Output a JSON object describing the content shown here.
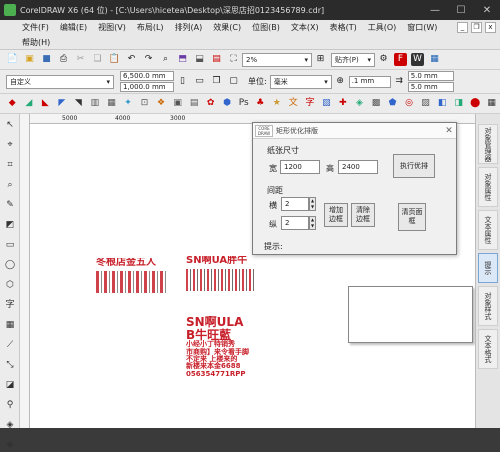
{
  "window": {
    "title": "CorelDRAW X6 (64 位) - [C:\\Users\\hicetea\\Desktop\\深思店招0123456789.cdr]",
    "minimize": "—",
    "maximize": "☐",
    "close": "✕"
  },
  "menu": {
    "items": [
      "文件(F)",
      "编辑(E)",
      "视图(V)",
      "布局(L)",
      "排列(A)",
      "效果(C)",
      "位图(B)",
      "文本(X)",
      "表格(T)",
      "工具(O)",
      "窗口(W)"
    ],
    "help": "帮助(H)"
  },
  "toolbar1": {
    "zoom": "2%",
    "snap": "贴齐(P)"
  },
  "toolbar2": {
    "page_size": "自定义",
    "width": "6,500.0 mm",
    "height": "1,000.0 mm",
    "units_label": "单位:",
    "units": "毫米",
    "nudge": ".1 mm",
    "dup_x": "5.0 mm",
    "dup_y": "5.0 mm"
  },
  "ruler": {
    "ticks": [
      "5000",
      "4000",
      "3000"
    ]
  },
  "dialog": {
    "logo_text": "CORE DRAW",
    "title": "矩形优化排版",
    "paper_label": "纸张尺寸",
    "width_label": "宽",
    "width_value": "1200",
    "height_label": "高",
    "height_value": "2400",
    "run_button": "执行优排",
    "spacing_label": "间距",
    "horiz_label": "横",
    "horiz_value": "2",
    "vert_label": "纵",
    "vert_value": "2",
    "add_border": "增加边框",
    "clear_border": "清除边框",
    "clear_page": "清页面框",
    "hint_label": "提示:"
  },
  "artwork": {
    "a1": "冬根店金五人",
    "a2": "SN啊UA胖牛",
    "a3_line1": "SN啊ULA",
    "a3_line2": "B牛旺藍",
    "a3_line3": "小经小丁特销秀",
    "a3_line4": "市商购】来令看手脚",
    "a3_line5": "不定来 上楼来的",
    "a3_line6": "新楼来本金6688",
    "a3_line7": "056354771RPP"
  },
  "dock": {
    "tabs": [
      "对象管理器",
      "对象属性",
      "文本属性",
      "提示",
      "对象样式",
      "文本格式"
    ]
  },
  "colors": {
    "accent_red": "#c8202a",
    "dialog_bg": "#f0f0f0",
    "titlebar": "#2b2b2b"
  }
}
